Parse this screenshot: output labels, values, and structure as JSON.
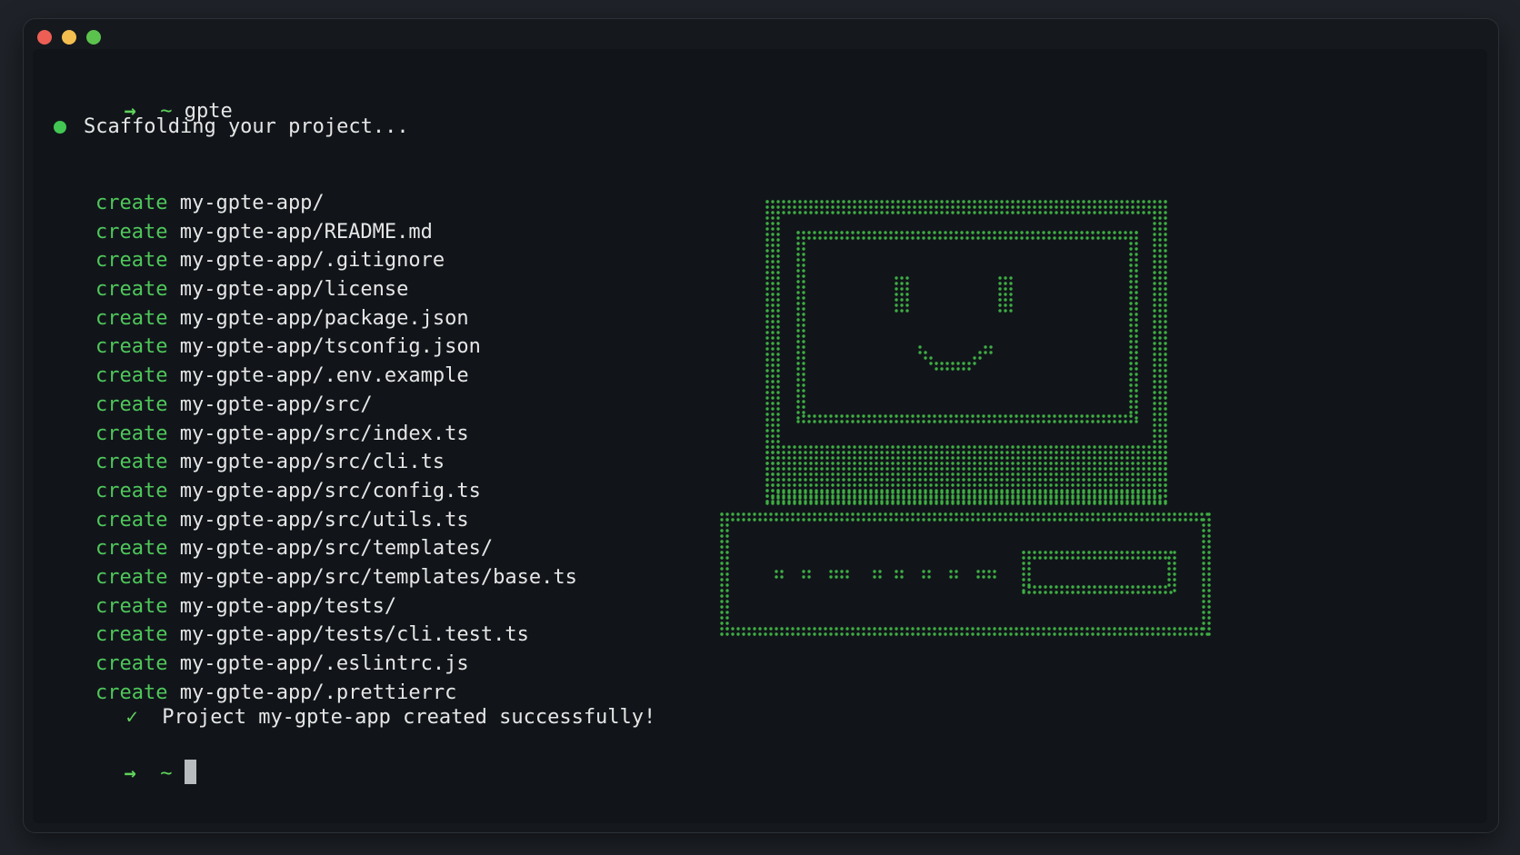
{
  "window": {
    "controls": [
      "close",
      "minimize",
      "maximize"
    ]
  },
  "terminal": {
    "prompt_symbol": "→",
    "prompt_dir": "~",
    "command": "gpte",
    "status_message": "Scaffolding your project...",
    "create_label": "create",
    "files": [
      "my-gpte-app/",
      "my-gpte-app/README.md",
      "my-gpte-app/.gitignore",
      "my-gpte-app/license",
      "my-gpte-app/package.json",
      "my-gpte-app/tsconfig.json",
      "my-gpte-app/.env.example",
      "my-gpte-app/src/",
      "my-gpte-app/src/index.ts",
      "my-gpte-app/src/cli.ts",
      "my-gpte-app/src/config.ts",
      "my-gpte-app/src/utils.ts",
      "my-gpte-app/src/templates/",
      "my-gpte-app/src/templates/base.ts",
      "my-gpte-app/tests/",
      "my-gpte-app/tests/cli.test.ts",
      "my-gpte-app/.eslintrc.js",
      "my-gpte-app/.prettierrc"
    ],
    "success_check": "✓",
    "success_message": "Project my-gpte-app created successfully!"
  },
  "colors": {
    "accent_green": "#5fd35a",
    "terminal_bg": "#11151a",
    "text": "#e6e6e6",
    "ascii_dot": "#3fae43"
  },
  "icons": {
    "close": "red-traffic-light",
    "minimize": "yellow-traffic-light",
    "maximize": "green-traffic-light",
    "ascii_art": "smiling-computer-icon"
  }
}
